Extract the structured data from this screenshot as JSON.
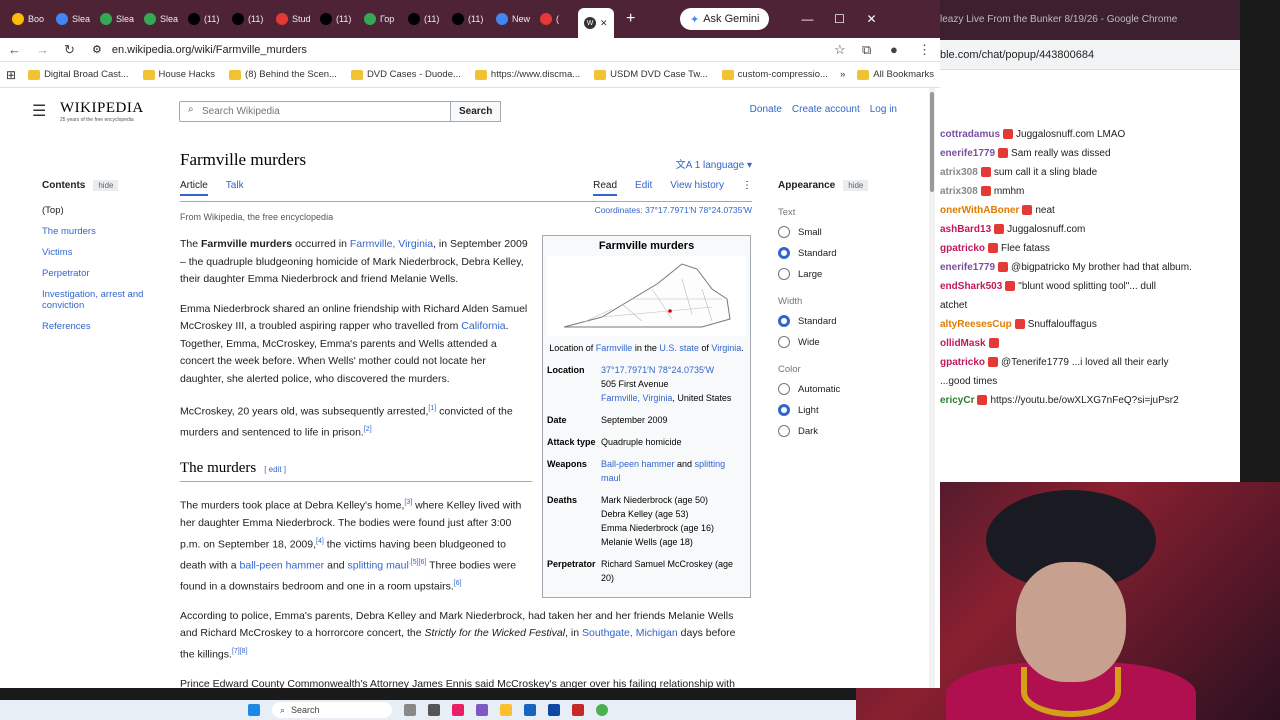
{
  "chrome": {
    "tabs": [
      {
        "label": "Boo",
        "icon": "star-icon",
        "color": "#fbbc04"
      },
      {
        "label": "Slea",
        "icon": "rumble-icon",
        "color": "#4285f4"
      },
      {
        "label": "Slea",
        "icon": "play-icon",
        "color": "#34a853"
      },
      {
        "label": "Slea",
        "icon": "play-icon",
        "color": "#34a853"
      },
      {
        "label": "(11)",
        "icon": "x-icon",
        "color": "#000"
      },
      {
        "label": "(11)",
        "icon": "x-icon",
        "color": "#000"
      },
      {
        "label": "Stud",
        "icon": "youtube-studio-icon",
        "color": "#e53935"
      },
      {
        "label": "(11)",
        "icon": "x-icon",
        "color": "#000"
      },
      {
        "label": "Гор",
        "icon": "play-icon",
        "color": "#34a853"
      },
      {
        "label": "(11)",
        "icon": "x-icon",
        "color": "#000"
      },
      {
        "label": "(11)",
        "icon": "x-icon",
        "color": "#000"
      },
      {
        "label": "New",
        "icon": "chrome-icon",
        "color": "#4285f4"
      },
      {
        "label": "(",
        "icon": "youtube-icon",
        "color": "#e53935"
      }
    ],
    "active_tab_icon": "W",
    "gemini_label": "Ask Gemini",
    "url": "en.wikipedia.org/wiki/Farmville_murders",
    "bookmarks": [
      "Digital Broad Cast...",
      "House Hacks",
      "(8) Behind the Scen...",
      "DVD Cases - Duode...",
      "https://www.discma...",
      "USDM DVD Case Tw...",
      "custom-compressio..."
    ],
    "all_bookmarks": "All Bookmarks"
  },
  "background_window": {
    "title": "leazy Live From the Bunker 8/19/26 - Google Chrome",
    "url": "ble.com/chat/popup/443800684",
    "chat": [
      {
        "user": "cottradamus",
        "text": "Juggalosnuff.com LMAO",
        "color": "#7b4fa0"
      },
      {
        "user": "enerife1779",
        "text": "Sam really was dissed",
        "color": "#7b4fa0"
      },
      {
        "user": "atrix308",
        "text": "sum call it a sling blade",
        "color": "#888"
      },
      {
        "user": "atrix308",
        "text": "mmhm",
        "color": "#888"
      },
      {
        "user": "onerWithABoner",
        "text": "neat",
        "color": "#e07b00"
      },
      {
        "user": "ashBard13",
        "text": "Juggalosnuff.com",
        "color": "#c2185b"
      },
      {
        "user": "gpatricko",
        "text": "Flee fatass",
        "color": "#c2185b"
      },
      {
        "user": "enerife1779",
        "text": "@bigpatricko My brother had that album.",
        "color": "#7b4fa0"
      },
      {
        "user": "endShark503",
        "text": "\"blunt wood splitting tool\"... dull",
        "color": "#c2185b"
      },
      {
        "user": "",
        "text": "atchet",
        "color": "#222"
      },
      {
        "user": "altyReesesCup",
        "text": "Snuffalouffagus",
        "color": "#e07b00"
      },
      {
        "user": "ollidMask",
        "text": "",
        "color": "#c2185b"
      },
      {
        "user": "gpatricko",
        "text": "@Tenerife1779 ...i loved all their early",
        "color": "#c2185b"
      },
      {
        "user": "",
        "text": "...good times",
        "color": "#222"
      },
      {
        "user": "ericyCr",
        "text": "https://youtu.be/owXLXG7nFeQ?si=juPsr2",
        "color": "#2e7d32"
      }
    ]
  },
  "wiki": {
    "logo": "WIKIPEDIA",
    "tagline": "25 years of the free encyclopedia",
    "search_placeholder": "Search Wikipedia",
    "search_button": "Search",
    "donate": "Donate",
    "create_account": "Create account",
    "login": "Log in",
    "toc_title": "Contents",
    "toc_hide": "hide",
    "toc": [
      "(Top)",
      "The murders",
      "Victims",
      "Perpetrator",
      "Investigation, arrest and conviction",
      "References"
    ],
    "title": "Farmville murders",
    "language": "1 language",
    "tab_article": "Article",
    "tab_talk": "Talk",
    "tab_read": "Read",
    "tab_edit": "Edit",
    "tab_history": "View history",
    "from": "From Wikipedia, the free encyclopedia",
    "coords": "Coordinates: 37°17.7971′N 78°24.0735′W",
    "infobox": {
      "title": "Farmville murders",
      "caption_a": "Location of ",
      "caption_link1": "Farmville",
      "caption_b": " in the ",
      "caption_link2": "U.S. state",
      "caption_c": " of ",
      "caption_link3": "Virginia",
      "location_label": "Location",
      "location_coords": "37°17.7971′N 78°24.0735′W",
      "location_address": "505 First Avenue",
      "location_place": "Farmville, Virginia",
      "location_country": ", United States",
      "date_label": "Date",
      "date": "September 2009",
      "attack_label": "Attack type",
      "attack": "Quadruple homicide",
      "weapons_label": "Weapons",
      "weapon1": "Ball-peen hammer",
      "weapon_and": " and ",
      "weapon2": "splitting maul",
      "deaths_label": "Deaths",
      "deaths": [
        "Mark Niederbrock (age 50)",
        "Debra Kelley (age 53)",
        "Emma Niederbrock (age 16)",
        "Melanie Wells (age 18)"
      ],
      "perp_label": "Perpetrator",
      "perp": "Richard Samuel McCroskey (age 20)"
    },
    "para1_a": "The ",
    "para1_bold": "Farmville murders",
    "para1_b": " occurred in ",
    "para1_link": "Farmville, Virginia",
    "para1_c": ", in September 2009 – the quadruple bludgeoning homicide of Mark Niederbrock, Debra Kelley, their daughter Emma Niederbrock and friend Melanie Wells.",
    "para2_a": "Emma Niederbrock shared an online friendship with Richard Alden Samuel McCroskey III, a troubled aspiring rapper who travelled from ",
    "para2_link": "California",
    "para2_b": ". Together, Emma, McCroskey, Emma's parents and Wells attended a concert the week before. When Wells' mother could not locate her daughter, she alerted police, who discovered the murders.",
    "para3_a": "McCroskey, 20 years old, was subsequently arrested,",
    "para3_ref1": "[1]",
    "para3_b": " convicted of the murders and sentenced to life in prison.",
    "para3_ref2": "[2]",
    "h2": "The murders",
    "h2_edit": "[ edit ]",
    "para4_a": "The murders took place at Debra Kelley's home,",
    "para4_ref1": "[3]",
    "para4_b": " where Kelley lived with her daughter Emma Niederbrock. The bodies were found just after 3:00 p.m. on September 18, 2009,",
    "para4_ref2": "[4]",
    "para4_c": " the victims having been bludgeoned to death with a ",
    "para4_link1": "ball-peen hammer",
    "para4_d": " and ",
    "para4_link2": "splitting maul",
    "para4_ref3": ".[5][6]",
    "para4_e": " Three bodies were found in a downstairs bedroom and one in a room upstairs.",
    "para4_ref4": "[6]",
    "para5_a": "According to police, Emma's parents, Debra Kelley and Mark Niederbrock, had taken her and her friends Melanie Wells and Richard McCroskey to a horrorcore concert, the ",
    "para5_italic": "Strictly for the Wicked Festival",
    "para5_b": ", in ",
    "para5_link": "Southgate, Michigan",
    "para5_c": " days before the killings.",
    "para5_ref": "[7][8]",
    "para6": "Prince Edward County Commonwealth's Attorney James Ennis said McCroskey's anger over his failing relationship with Emma and text messages she had sent while they were in Michigan led to the killings. After the four returned to Virginia, McCroskey became increasingly distraught about the relationship, as he had an expectation that he and Emma",
    "appearance_title": "Appearance",
    "appearance_hide": "hide",
    "text_label": "Text",
    "text_opts": [
      "Small",
      "Standard",
      "Large"
    ],
    "width_label": "Width",
    "width_opts": [
      "Standard",
      "Wide"
    ],
    "color_label": "Color",
    "color_opts": [
      "Automatic",
      "Light",
      "Dark"
    ]
  },
  "taskbar": {
    "search": "Search"
  }
}
